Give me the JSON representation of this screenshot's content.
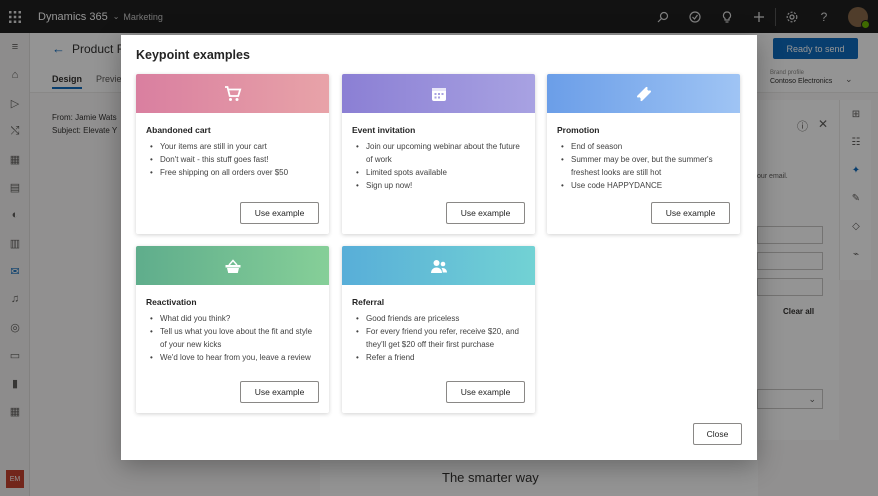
{
  "topbar": {
    "app_title": "Dynamics 365",
    "area": "Marketing",
    "icons": [
      "waffle-icon",
      "search-icon",
      "task-icon",
      "lightbulb-icon",
      "plus-icon",
      "settings-icon",
      "help-icon"
    ]
  },
  "background": {
    "page_title": "Product F",
    "tabs": [
      "Design",
      "Previe"
    ],
    "ready_button": "Ready to send",
    "brand_label": "Brand profile",
    "brand_value": "Contoso Electronics",
    "from": "From: Jamie Wats",
    "subject": "Subject: Elevate Y",
    "email_hint": "our email.",
    "clear_all": "Clear all",
    "canvas_text": "The smarter way",
    "user_initials": "EM"
  },
  "modal": {
    "title": "Keypoint examples",
    "close_label": "Close",
    "cards": [
      {
        "title": "Abandoned cart",
        "icon": "cart-icon",
        "color_from": "#d97fa0",
        "color_to": "#e8a3a8",
        "bullets": [
          "Your items are still in your cart",
          "Don't wait - this stuff goes fast!",
          "Free shipping on all orders over $50"
        ],
        "button": "Use example"
      },
      {
        "title": "Event invitation",
        "icon": "calendar-icon",
        "color_from": "#8b7fd4",
        "color_to": "#a8a2e2",
        "bullets": [
          "Join our upcoming webinar about the future of work",
          "Limited spots available",
          "Sign up now!"
        ],
        "button": "Use example"
      },
      {
        "title": "Promotion",
        "icon": "ticket-icon",
        "color_from": "#6b9ee8",
        "color_to": "#9fc4f4",
        "bullets": [
          "End of season",
          "Summer may be over, but the summer's freshest looks are still hot",
          "Use code HAPPYDANCE"
        ],
        "button": "Use example"
      },
      {
        "title": "Reactivation",
        "icon": "basket-icon",
        "color_from": "#5fad8c",
        "color_to": "#86cf98",
        "bullets": [
          "What did you think?",
          "Tell us what you love about the fit and style of your new kicks",
          "We'd love to hear from you, leave a review"
        ],
        "button": "Use example"
      },
      {
        "title": "Referral",
        "icon": "people-icon",
        "color_from": "#58aed8",
        "color_to": "#72d2d4",
        "bullets": [
          "Good friends are priceless",
          "For every friend you refer, receive $20, and they'll get $20 off their first purchase",
          "Refer a friend"
        ],
        "button": "Use example"
      }
    ]
  }
}
